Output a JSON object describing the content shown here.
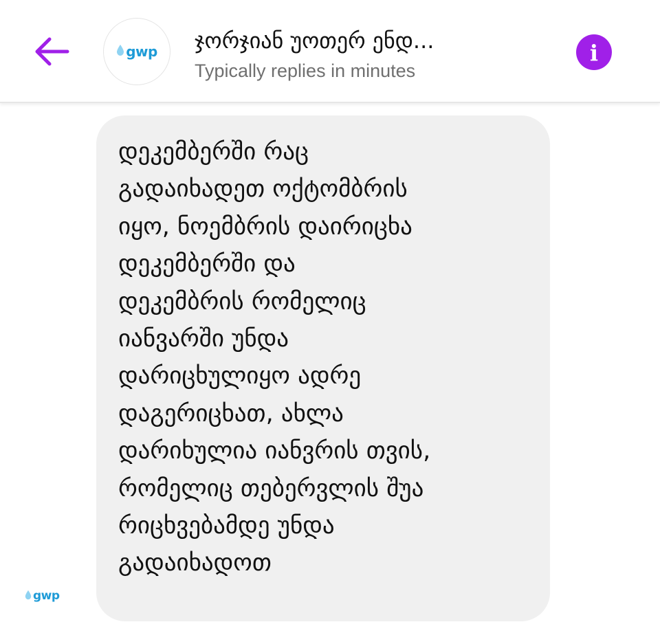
{
  "header": {
    "back_icon": "arrow-left-icon",
    "avatar_logo": "gwp",
    "title": "ჯორჯიან უოთერ ენდ...",
    "subtitle": "Typically replies in minutes",
    "info_icon": "info-icon",
    "accent_color": "#a020e8"
  },
  "conversation": {
    "sender_logo": "gwp",
    "message": "დეკემბერში რაც\nგადაიხადეთ  ოქტომბრის\nიყო, ნოემბრის დაირიცხა\nდეკემბერში და\nდეკემბრის რომელიც\nიანვარში უნდა\nდარიცხულიყო ადრე\nდაგერიცხათ, ახლა\nდარიხულია იანვრის თვის,\nრომელიც თებერვლის შუა\nრიცხვებამდე უნდა\nგადაიხადოთ"
  }
}
